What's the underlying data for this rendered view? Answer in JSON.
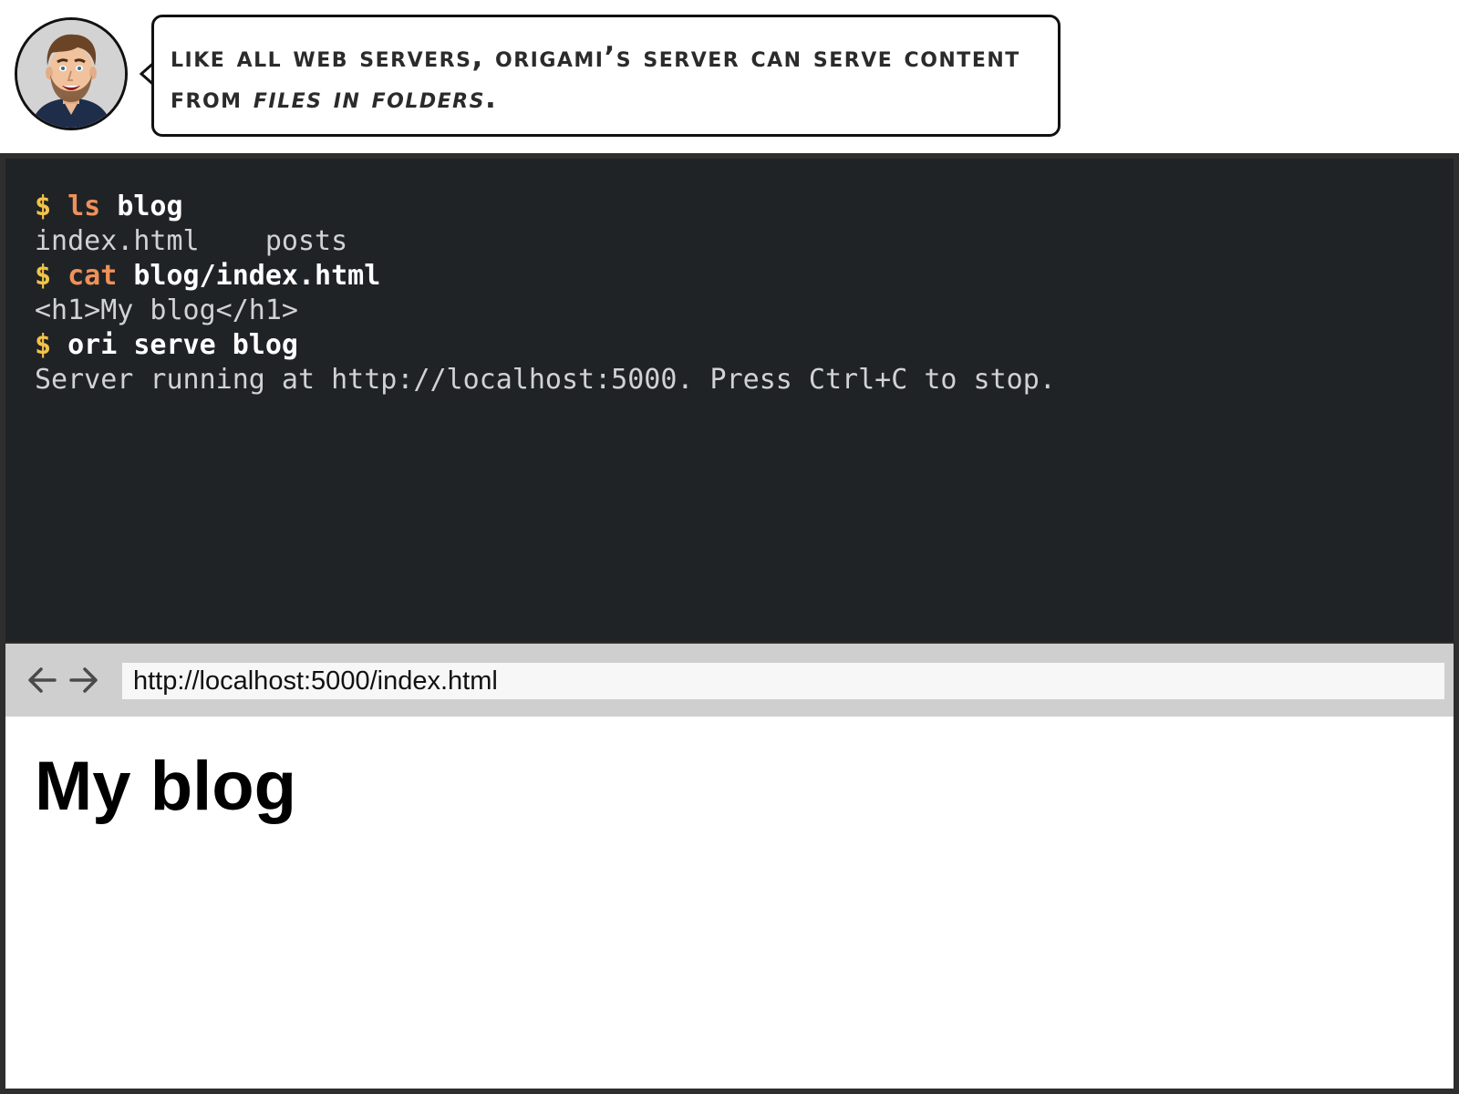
{
  "narration": {
    "avatar_icon": "cartoon-man-portrait",
    "text_before": "Like all web servers, Origami’s server can serve content from ",
    "text_emphasis": "files in folders",
    "text_after": "."
  },
  "terminal": {
    "lines": [
      {
        "type": "command",
        "prompt": "$",
        "command": "ls",
        "args": "blog"
      },
      {
        "type": "output",
        "text": "index.html    posts"
      },
      {
        "type": "command",
        "prompt": "$",
        "command": "cat",
        "args": "blog/index.html"
      },
      {
        "type": "output",
        "text": "<h1>My blog</h1>"
      },
      {
        "type": "command",
        "prompt": "$",
        "command": "",
        "args": "ori serve blog"
      },
      {
        "type": "output",
        "text": "Server running at http://localhost:5000. Press Ctrl+C to stop."
      }
    ],
    "colors": {
      "background": "#1f2326",
      "prompt": "#f2c34a",
      "command": "#f0915a",
      "args": "#ffffff",
      "output": "#d2d2d2"
    }
  },
  "browser": {
    "back_icon": "arrow-left-icon",
    "forward_icon": "arrow-right-icon",
    "url": "http://localhost:5000/index.html",
    "page": {
      "heading": "My blog"
    }
  }
}
